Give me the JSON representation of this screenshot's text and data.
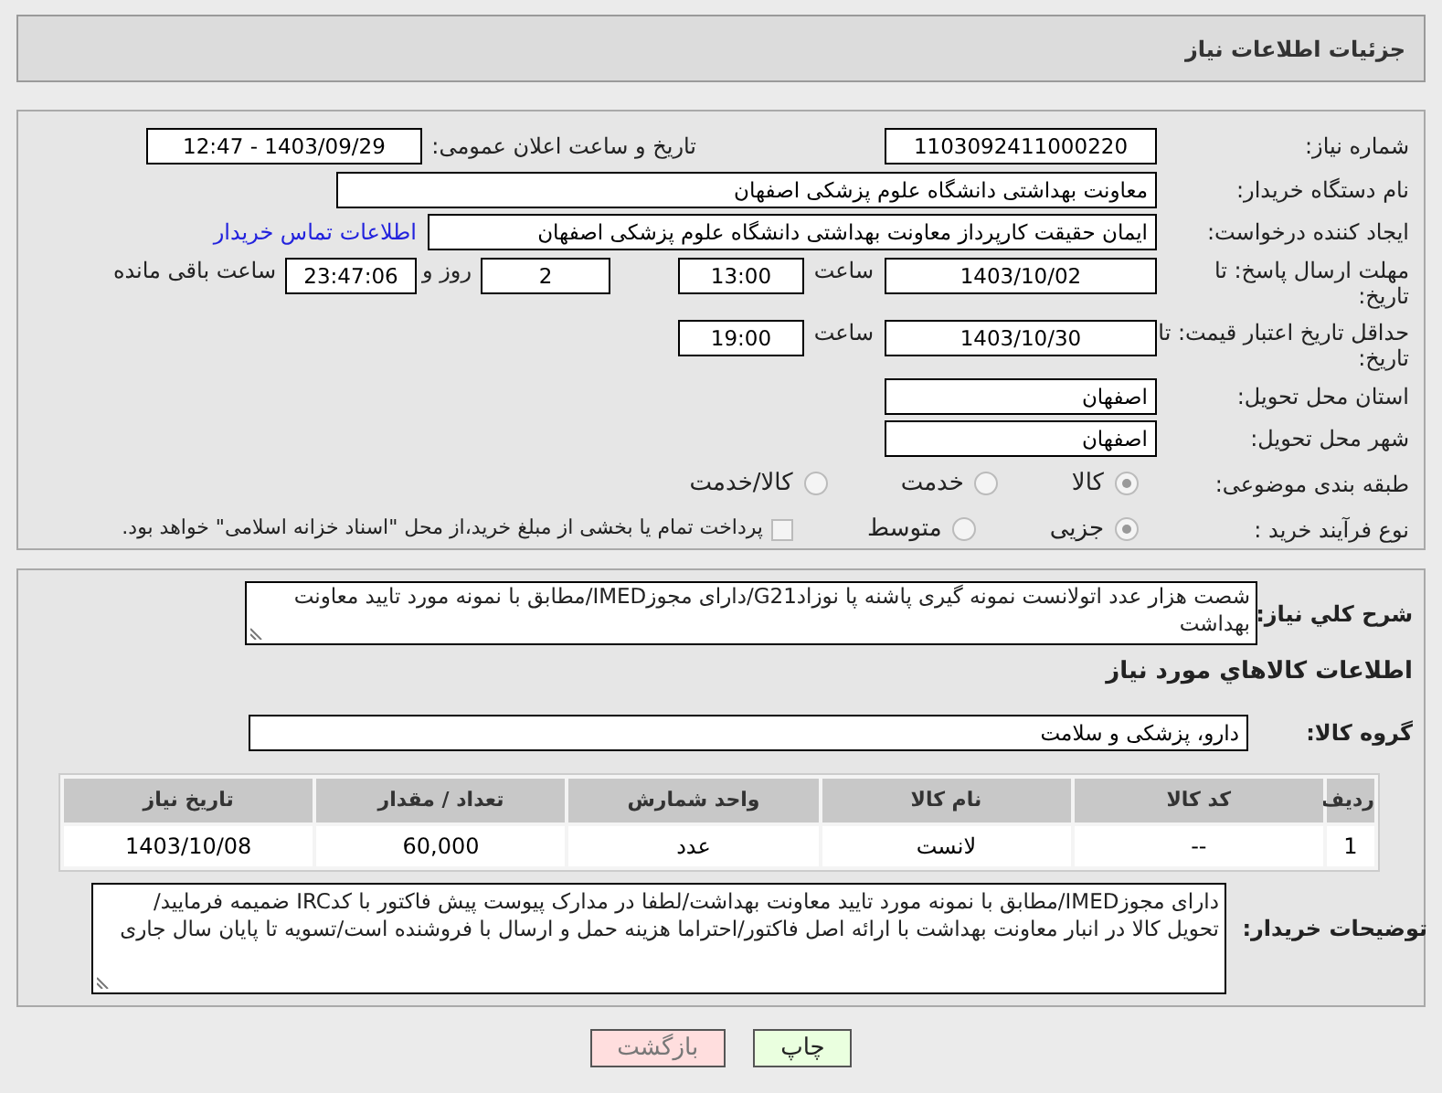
{
  "header": {
    "title": "جزئیات اطلاعات نیاز"
  },
  "need_number": {
    "label": "شماره نیاز:",
    "value": "1103092411000220"
  },
  "announce": {
    "label": "تاریخ و ساعت اعلان عمومی:",
    "value": "1403/09/29 - 12:47"
  },
  "buyer_org": {
    "label": "نام دستگاه خریدار:",
    "value": "معاونت بهداشتی دانشگاه علوم پزشکی اصفهان"
  },
  "requester": {
    "label": "ایجاد کننده درخواست:",
    "value": "ایمان حقیقت کارپرداز معاونت بهداشتی دانشگاه علوم پزشکی اصفهان",
    "link": "اطلاعات تماس خریدار"
  },
  "response_deadline": {
    "label": "مهلت ارسال پاسخ: تا تاریخ:",
    "date": "1403/10/02",
    "time_label": "ساعت",
    "time": "13:00",
    "days": "2",
    "days_label": "روز و",
    "remaining": "23:47:06",
    "remaining_label": "ساعت باقی مانده"
  },
  "price_validity": {
    "label": "حداقل تاریخ اعتبار قیمت: تا تاریخ:",
    "date": "1403/10/30",
    "time_label": "ساعت",
    "time": "19:00"
  },
  "province": {
    "label": "استان محل تحویل:",
    "value": "اصفهان"
  },
  "city": {
    "label": "شهر محل تحویل:",
    "value": "اصفهان"
  },
  "category": {
    "label": "طبقه بندی موضوعی:",
    "options": [
      {
        "label": "کالا",
        "selected": true
      },
      {
        "label": "خدمت",
        "selected": false
      },
      {
        "label": "کالا/خدمت",
        "selected": false
      }
    ]
  },
  "process": {
    "label": "نوع فرآیند خرید :",
    "options": [
      {
        "label": "جزیی",
        "selected": true
      },
      {
        "label": "متوسط",
        "selected": false
      }
    ],
    "treasury": {
      "label": "پرداخت تمام یا بخشی از مبلغ خرید،از محل \"اسناد خزانه اسلامی\" خواهد بود.",
      "checked": false
    }
  },
  "description": {
    "label": "شرح کلي نياز:",
    "value": "شصت هزار عدد اتولانست نمونه گیری پاشنه پا نوزادG21/دارای مجوزIMED/مطابق با نمونه مورد تایید معاونت بهداشت"
  },
  "goods_title": "اطلاعات كالاهاي مورد نياز",
  "goods_group": {
    "label": "گروه کالا:",
    "value": "دارو، پزشکی و سلامت"
  },
  "table": {
    "columns": [
      "ردیف",
      "کد کالا",
      "نام کالا",
      "واحد شمارش",
      "تعداد / مقدار",
      "تاریخ نیاز"
    ],
    "rows": [
      [
        "1",
        "--",
        "لانست",
        "عدد",
        "60,000",
        "1403/10/08"
      ]
    ]
  },
  "buyer_notes": {
    "label": "توضیحات خریدار:",
    "value": "دارای مجوزIMED/مطابق با نمونه مورد تایید معاونت بهداشت/لطفا در مدارک پیوست پیش فاکتور با کدIRC ضمیمه فرمایید/ تحویل کالا در انبار معاونت بهداشت با ارائه اصل فاکتور/احتراما هزینه حمل و ارسال با فروشنده است/تسویه تا پایان سال جاری"
  },
  "buttons": [
    {
      "label": "چاپ",
      "kind": "print"
    },
    {
      "label": "بازگشت",
      "kind": "back"
    }
  ]
}
